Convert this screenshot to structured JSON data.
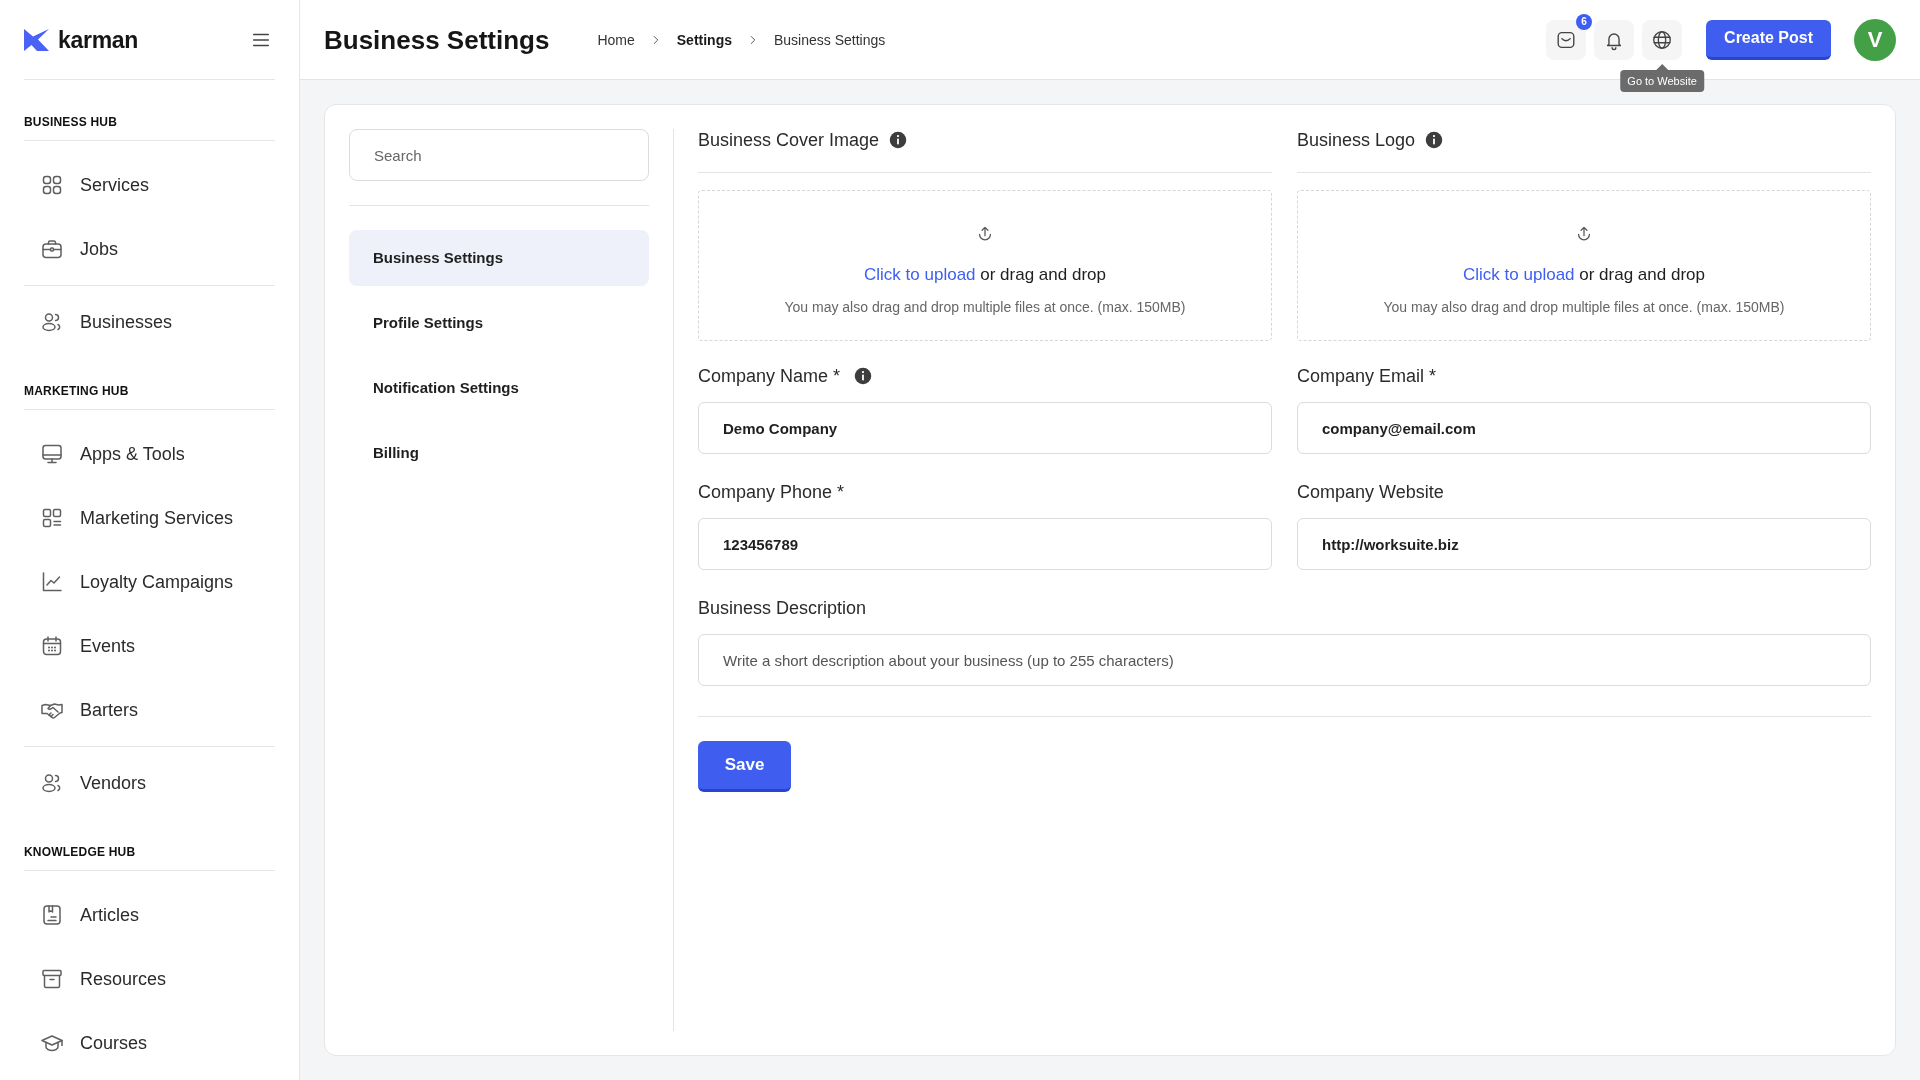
{
  "brand": {
    "name": "karman"
  },
  "sidebar": {
    "sections": [
      {
        "title": "BUSINESS HUB",
        "groups": [
          {
            "items": [
              "Services",
              "Jobs"
            ]
          },
          {
            "items": [
              "Businesses"
            ]
          }
        ]
      },
      {
        "title": "MARKETING HUB",
        "groups": [
          {
            "items": [
              "Apps & Tools",
              "Marketing Services",
              "Loyalty Campaigns",
              "Events",
              "Barters"
            ]
          },
          {
            "items": [
              "Vendors"
            ]
          }
        ]
      },
      {
        "title": "KNOWLEDGE HUB",
        "groups": [
          {
            "items": [
              "Articles",
              "Resources",
              "Courses"
            ]
          }
        ]
      }
    ]
  },
  "header": {
    "title": "Business Settings",
    "breadcrumbs": [
      {
        "label": "Home",
        "emphasized": false
      },
      {
        "label": "Settings",
        "emphasized": true
      },
      {
        "label": "Business Settings",
        "emphasized": false
      }
    ],
    "messages_badge": "6",
    "website_tooltip": "Go to Website",
    "create_button": "Create Post",
    "avatar_initial": "V"
  },
  "settings_menu": {
    "search": {
      "placeholder": "Search"
    },
    "items": [
      {
        "label": "Business Settings",
        "selected": true
      },
      {
        "label": "Profile Settings",
        "selected": false
      },
      {
        "label": "Notification Settings",
        "selected": false
      },
      {
        "label": "Billing",
        "selected": false
      }
    ]
  },
  "uploads": [
    {
      "label": "Business Cover Image",
      "info": true,
      "link": "Click to upload",
      "prompt": "or drag and drop",
      "hint": "You may also drag and drop multiple files at once. (max. 150MB)"
    },
    {
      "label": "Business Logo",
      "info": true,
      "link": "Click to upload",
      "prompt": "or drag and drop",
      "hint": "You may also drag and drop multiple files at once. (max. 150MB)"
    }
  ],
  "fields": [
    {
      "label": "Company Name *",
      "info": true,
      "value": "Demo Company"
    },
    {
      "label": "Company Email *",
      "info": false,
      "value": "company@email.com"
    },
    {
      "label": "Company Phone *",
      "info": false,
      "value": "123456789"
    },
    {
      "label": "Company Website",
      "info": false,
      "value": "http://worksuite.biz"
    }
  ],
  "description": {
    "label": "Business Description",
    "placeholder": "Write a short description about your business (up to 255 characters)"
  },
  "save_button": "Save"
}
